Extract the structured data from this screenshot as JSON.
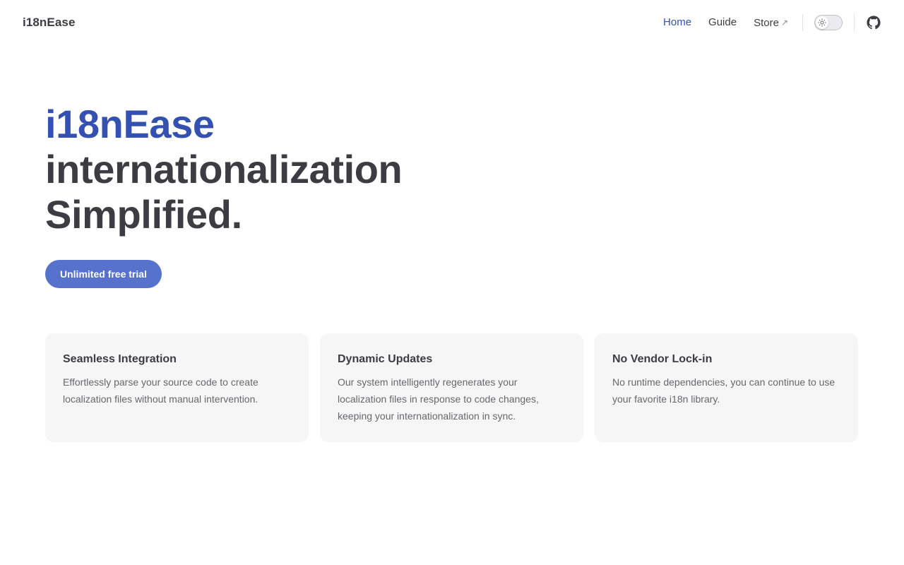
{
  "header": {
    "brand": "i18nEase",
    "nav": [
      {
        "label": "Home",
        "active": true
      },
      {
        "label": "Guide"
      },
      {
        "label": "Store",
        "external_icon": "arrow-up-right-icon"
      }
    ],
    "theme_toggle_icon": "sun-icon",
    "social_icon": "github-icon"
  },
  "hero": {
    "name": "i18nEase",
    "text_line1": "internationalization",
    "text_line2": "Simplified.",
    "cta_label": "Unlimited free trial"
  },
  "features": [
    {
      "title": "Seamless Integration",
      "details": "Effortlessly parse your source code to create localization files without manual intervention."
    },
    {
      "title": "Dynamic Updates",
      "details": "Our system intelligently regenerates your localization files in response to code changes, keeping your internationalization in sync."
    },
    {
      "title": "No Vendor Lock-in",
      "details": "No runtime dependencies, you can continue to use your favorite i18n library."
    }
  ],
  "colors": {
    "brand": "#3451b2",
    "button": "#5672cd",
    "text": "#3c3c43",
    "card_bg": "#f6f6f7"
  }
}
